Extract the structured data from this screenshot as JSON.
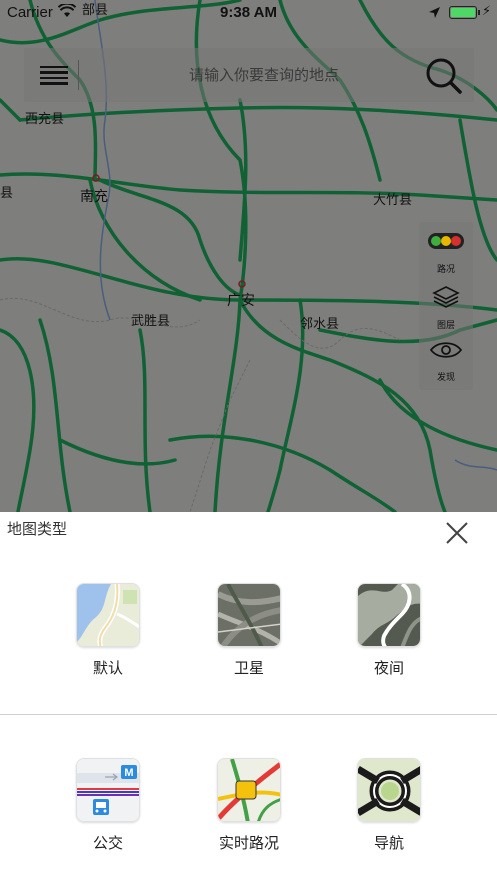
{
  "status_bar": {
    "carrier": "Carrier",
    "time": "9:38 AM"
  },
  "search": {
    "placeholder": "请输入你要查询的地点"
  },
  "map_labels": [
    {
      "name": "部县",
      "text": "部县"
    },
    {
      "name": "西充县",
      "text": "西充县"
    },
    {
      "name": "南充",
      "text": "南充"
    },
    {
      "name": "大竹县",
      "text": "大竹县"
    },
    {
      "name": "广安",
      "text": "广安"
    },
    {
      "name": "武胜县",
      "text": "武胜县"
    },
    {
      "name": "邻水县",
      "text": "邻水县"
    },
    {
      "name": "县",
      "text": "县"
    }
  ],
  "tools": {
    "traffic": "路况",
    "layers": "图层",
    "discover": "发现"
  },
  "sheet": {
    "title": "地图类型",
    "options": [
      {
        "label": "默认",
        "icon": "default-map-icon"
      },
      {
        "label": "卫星",
        "icon": "satellite-map-icon"
      },
      {
        "label": "夜间",
        "icon": "night-map-icon"
      },
      {
        "label": "公交",
        "icon": "bus-map-icon"
      },
      {
        "label": "实时路况",
        "icon": "traffic-map-icon"
      },
      {
        "label": "导航",
        "icon": "navigation-map-icon"
      }
    ]
  },
  "colors": {
    "road_green": "#19a85a",
    "battery_green": "#4cd964",
    "traffic_red": "#e53935",
    "traffic_yellow": "#f4c20d"
  }
}
